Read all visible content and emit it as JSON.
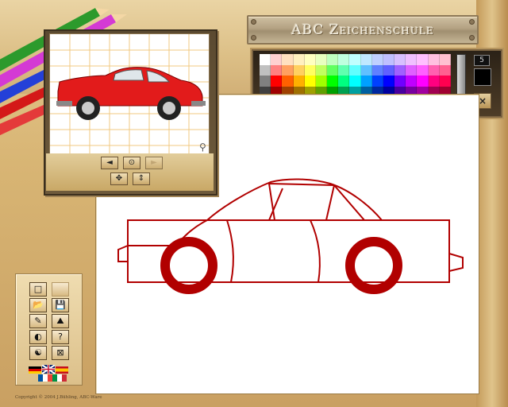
{
  "app": {
    "title": "ABC Zeichenschule",
    "copyright": "Copyright © 2004 J.Bühling, ABC-Ware"
  },
  "palette": {
    "brush_size": "5",
    "current_color": "#000000",
    "clear_symbol": "×",
    "columns": [
      [
        "#ffffff",
        "#c0c0c0",
        "#808080",
        "#404040",
        "#000000"
      ],
      [
        "#ffd0d0",
        "#ff8080",
        "#ff0000",
        "#a00000",
        "#500000"
      ],
      [
        "#ffe0c0",
        "#ffa060",
        "#ff6000",
        "#a04000",
        "#502000"
      ],
      [
        "#fff0c0",
        "#ffd060",
        "#ffb000",
        "#a07000",
        "#503800"
      ],
      [
        "#ffffc0",
        "#ffff60",
        "#ffff00",
        "#a0a000",
        "#505000"
      ],
      [
        "#e8ffc0",
        "#c0ff60",
        "#a0ff00",
        "#60a000",
        "#305000"
      ],
      [
        "#c0ffc0",
        "#60ff60",
        "#00ff00",
        "#00a000",
        "#005000"
      ],
      [
        "#c0ffe0",
        "#60ffb0",
        "#00ff80",
        "#00a050",
        "#005028"
      ],
      [
        "#c0ffff",
        "#60ffff",
        "#00ffff",
        "#00a0a0",
        "#005050"
      ],
      [
        "#c0e8ff",
        "#60c0ff",
        "#00a0ff",
        "#0060a0",
        "#003050"
      ],
      [
        "#c0d0ff",
        "#6080ff",
        "#0040ff",
        "#0028a0",
        "#001450"
      ],
      [
        "#c0c0ff",
        "#6060ff",
        "#0000ff",
        "#0000a0",
        "#000050"
      ],
      [
        "#d8c0ff",
        "#a060ff",
        "#7000ff",
        "#4800a0",
        "#240050"
      ],
      [
        "#f0c0ff",
        "#e060ff",
        "#c000ff",
        "#7800a0",
        "#3c0050"
      ],
      [
        "#ffc0ff",
        "#ff60ff",
        "#ff00ff",
        "#a000a0",
        "#500050"
      ],
      [
        "#ffc0e0",
        "#ff60b0",
        "#ff0080",
        "#a00050",
        "#500028"
      ],
      [
        "#ffc0d0",
        "#ff6090",
        "#ff0050",
        "#a00030",
        "#500018"
      ]
    ]
  },
  "template": {
    "buttons": {
      "prev": "◄",
      "view": "⊙",
      "next": "►",
      "move": "✥",
      "resize": "⇕"
    },
    "corner_icon": "⚲"
  },
  "tools": {
    "new": "□",
    "blank": "",
    "open": "📂",
    "save": "💾",
    "pencil": "✎",
    "image": "⛰",
    "toggle": "◐",
    "help": "?",
    "color": "☯",
    "close": "⊠"
  },
  "colors": {
    "drawing_stroke": "#b10000",
    "frame_dark": "#5b4a31"
  }
}
